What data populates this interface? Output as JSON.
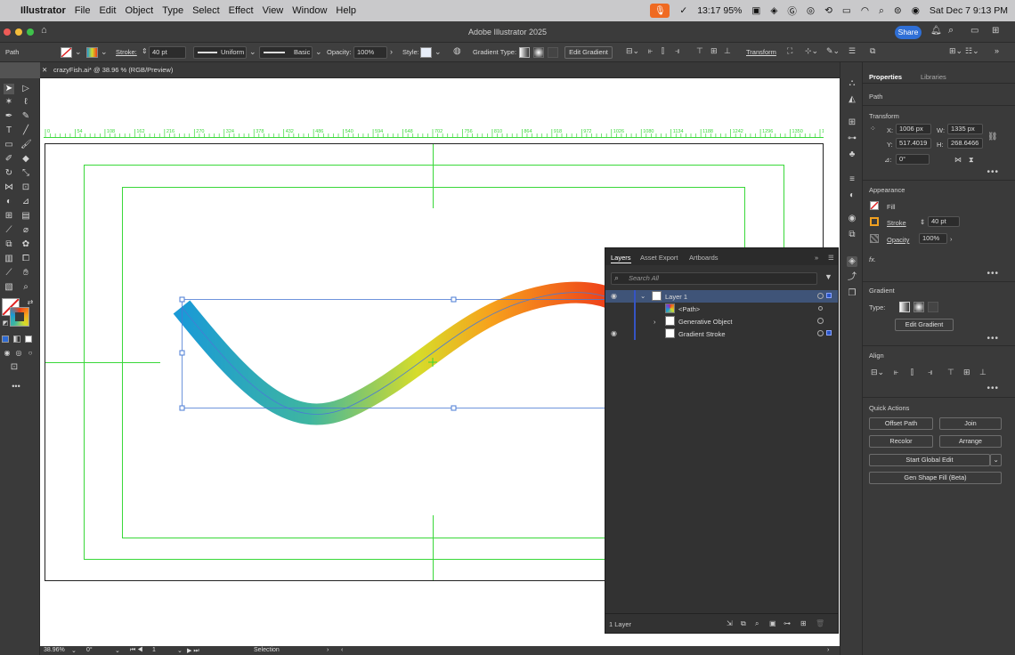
{
  "menubar": {
    "app_name": "Illustrator",
    "items": [
      "File",
      "Edit",
      "Object",
      "Type",
      "Select",
      "Effect",
      "View",
      "Window",
      "Help"
    ],
    "battery_time": "13:17 95%",
    "datetime": "Sat Dec 7  9:13 PM"
  },
  "window": {
    "title": "Adobe Illustrator 2025",
    "share_label": "Share"
  },
  "control_bar": {
    "selection_type": "Path",
    "stroke_label": "Stroke:",
    "stroke_value": "40 pt",
    "profile_label": "Uniform",
    "brush_label": "Basic",
    "opacity_label": "Opacity:",
    "opacity_value": "100%",
    "style_label": "Style:",
    "gradient_type_label": "Gradient Type:",
    "edit_gradient_label": "Edit Gradient",
    "transform_label": "Transform"
  },
  "document": {
    "tab_title": "crazyFish.ai* @ 38.96 % (RGB/Preview)",
    "ruler_ticks": [
      "0",
      "54",
      "108",
      "162",
      "216",
      "270",
      "324",
      "378",
      "432",
      "486",
      "540",
      "594",
      "648",
      "702",
      "756",
      "810",
      "864",
      "918",
      "972",
      "1026",
      "1080",
      "1134",
      "1188",
      "1242",
      "1296",
      "1350",
      "1404"
    ]
  },
  "status_bar": {
    "zoom": "38.96%",
    "rotation": "0°",
    "artboard_number": "1",
    "tool_name": "Selection"
  },
  "layers_panel": {
    "tabs": [
      "Layers",
      "Asset Export",
      "Artboards"
    ],
    "search_placeholder": "Search All",
    "rows": [
      {
        "name": "Layer 1"
      },
      {
        "name": "<Path>"
      },
      {
        "name": "Generative Object"
      },
      {
        "name": "Gradient Stroke"
      }
    ],
    "footer_count": "1 Layer"
  },
  "properties": {
    "tabs": [
      "Properties",
      "Libraries"
    ],
    "object_type": "Path",
    "transform": {
      "section_label": "Transform",
      "x_label": "X:",
      "x": "1006 px",
      "y_label": "Y:",
      "y": "517.4019",
      "w_label": "W:",
      "w": "1335 px",
      "h_label": "H:",
      "h": "268.6466",
      "rotate_label": "⊿:",
      "rotate": "0°"
    },
    "appearance": {
      "section_label": "Appearance",
      "fill_label": "Fill",
      "stroke_label": "Stroke",
      "stroke_value": "40 pt",
      "opacity_label": "Opacity",
      "opacity_value": "100%",
      "fx_label": "fx."
    },
    "gradient": {
      "section_label": "Gradient",
      "type_label": "Type:",
      "edit_button": "Edit Gradient"
    },
    "align": {
      "section_label": "Align"
    },
    "quick_actions": {
      "section_label": "Quick Actions",
      "offset_path": "Offset Path",
      "join": "Join",
      "recolor": "Recolor",
      "arrange": "Arrange",
      "start_global_edit": "Start Global Edit",
      "gen_shape_fill": "Gen Shape Fill (Beta)"
    }
  },
  "colors": {
    "accent": "#2f6fd6",
    "guide_green": "#39d839",
    "selection_blue": "#4a7bd4",
    "gradient_stops": [
      "#1a9ad6",
      "#3fb6a0",
      "#d6dc2a",
      "#f7a21c",
      "#ee3e1a"
    ]
  }
}
